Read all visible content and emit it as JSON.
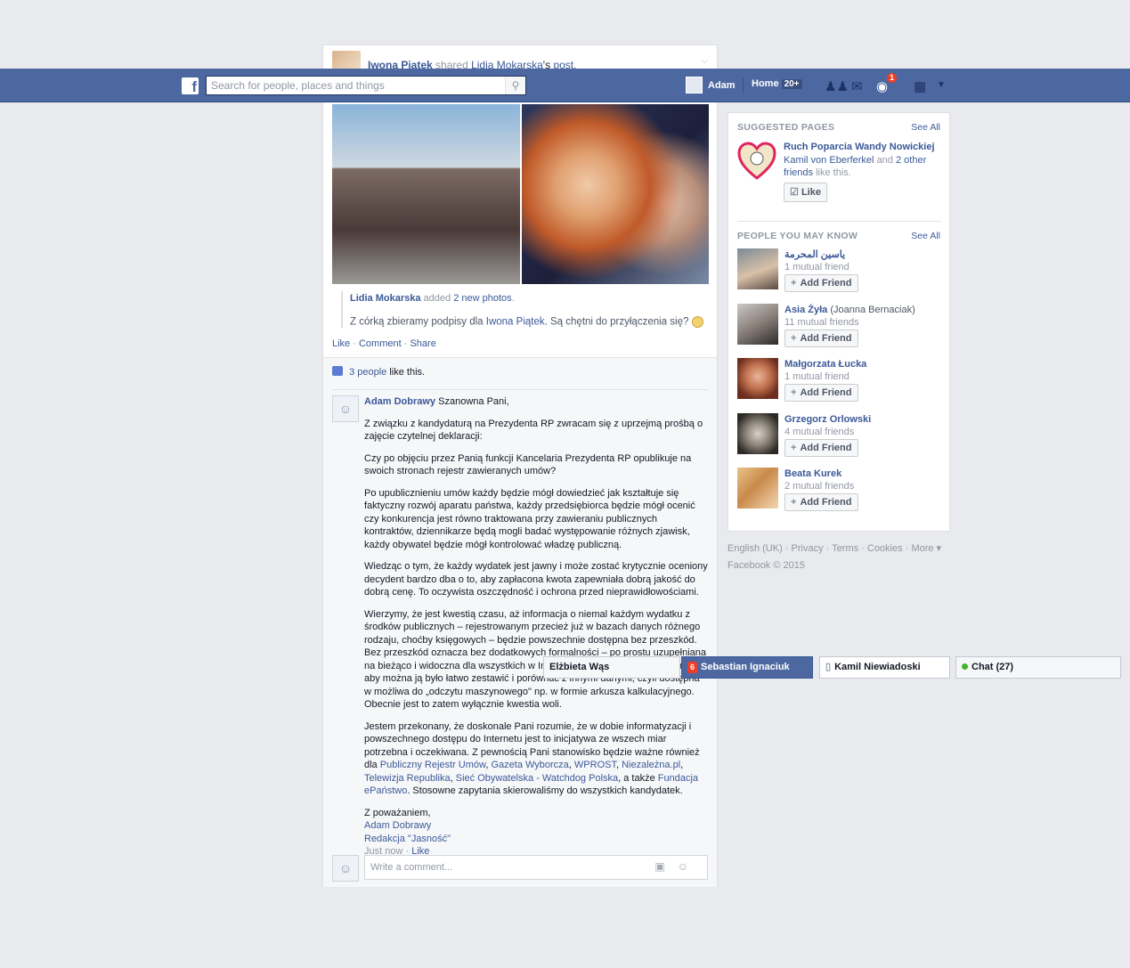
{
  "post": {
    "sharer": "Iwona Piatek",
    "shared_text": "shared",
    "original_author": "Lidia Mokarska",
    "possessive": "'s",
    "post_link": "post.",
    "shared_line_author": "Lidia Mokarska",
    "shared_line_added": "added",
    "shared_line_photos": "2 new photos",
    "shared_line_end": ".",
    "message_before": "Z córką zbieramy podpisy dla",
    "message_link": "Iwona Piątek",
    "message_after": ". Są chętni do przyłączenia się?",
    "action_like": "Like",
    "action_comment": "Comment",
    "action_share": "Share",
    "likes_count": "3 people",
    "likes_suffix": "like this."
  },
  "comment": {
    "author": "Adam Dobrawy",
    "greeting": "Szanowna Pani,",
    "p1": "Z związku z kandydaturą na Prezydenta RP zwracam się z uprzejmą prośbą o zajęcie czytelnej deklaracji:",
    "p2": "Czy po objęciu przez Panią funkcji Kancelaria Prezydenta RP opublikuje na swoich stronach rejestr zawieranych umów?",
    "p3": "Po upublicznieniu umów każdy będzie mógł dowiedzieć jak kształtuje się faktyczny rozwój aparatu państwa, każdy przedsiębiorca będzie mógł ocenić czy konkurencja jest równo traktowana przy zawieraniu publicznych kontraktów, dziennikarze będą mogli badać występowanie różnych zjawisk, każdy obywatel będzie mógł kontrolować władzę publiczną.",
    "p4": "Wiedząc o tym, że każdy wydatek jest jawny i może zostać krytycznie oceniony decydent bardzo dba o to, aby zapłacona kwota zapewniała dobrą jakość do dobrą cenę. To oczywista oszczędność i ochrona przed nieprawidłowościami.",
    "p5": "Wierzymy, że jest kwestią czasu, aż informacja o niemal każdym wydatku z środków publicznych – rejestrowanym przecież już w bazach danych różnego rodzaju, choćby księgowych – będzie powszechnie dostępna bez przeszkód. Bez przeszkód oznacza bez dodatkowych formalności – po prostu uzupełniana na bieżąco i widoczna dla wszystkich w Internecie. Co więcej udostepniana tak aby można ją było łatwo zestawić i porównać z innymi danymi, czyli dostępna w możliwa do „odczytu maszynowego\" np. w formie arkusza kalkulacyjnego. Obecnie jest to zatem wyłącznie kwestia woli.",
    "p6_before": "Jestem przekonany, że doskonale Pani rozumie, że w dobie informatyzacji i powszechnego dostępu do Internetu jest to inicjatywa ze wszech miar potrzebna i oczekiwana. Z pewnością Pani stanowisko będzie ważne również dla",
    "link1": "Publiczny Rejestr Umów",
    "link2": "Gazeta Wyborcza",
    "link3": "WPROST",
    "link4": "Niezależna.pl",
    "link5": "Telewizja Republika",
    "link6": "Sieć Obywatelska - Watchdog Polska",
    "also": ", a także",
    "link7": "Fundacja ePaństwo",
    "p6_after": ". Stosowne zapytania skierowaliśmy do wszystkich kandydatek.",
    "closing": "Z poważaniem,",
    "sign_name": "Adam Dobrawy",
    "sign_org": "Redakcja \"Jasność\"",
    "time": "Just now",
    "like": "Like",
    "write_placeholder": "Write a comment..."
  },
  "topbar": {
    "search_placeholder": "Search for people, places and things",
    "user": "Adam",
    "home": "Home",
    "home_count": "20+",
    "notif_count": "1"
  },
  "suggested": {
    "title": "SUGGESTED PAGES",
    "see_all": "See All",
    "page_name": "Ruch Poparcia Wandy Nowickiej",
    "friend1": "Kamil von Eberferkel",
    "and": "and",
    "others": "2 other friends",
    "like_this": "like this.",
    "like_btn": "Like"
  },
  "pymk": {
    "title": "PEOPLE YOU MAY KNOW",
    "see_all": "See All",
    "add_label": "Add Friend",
    "people": [
      {
        "name": "ياسين المحرمة",
        "extra": "",
        "mutual": "1 mutual friend"
      },
      {
        "name": "Asia Żyła",
        "extra": "(Joanna Bernaciak)",
        "mutual": "11 mutual friends"
      },
      {
        "name": "Małgorzata Łucka",
        "extra": "",
        "mutual": "1 mutual friend"
      },
      {
        "name": "Grzegorz Orlowski",
        "extra": "",
        "mutual": "4 mutual friends"
      },
      {
        "name": "Beata Kurek",
        "extra": "",
        "mutual": "2 mutual friends"
      }
    ]
  },
  "footer": {
    "links": [
      "English (UK)",
      "Privacy",
      "Terms",
      "Cookies",
      "More"
    ],
    "copyright": "Facebook © 2015"
  },
  "chat": {
    "tab1": "Elżbieta Wąs",
    "tab2_count": "6",
    "tab2": "Sebastian Ignaciuk",
    "tab3": "Kamil Niewiadoski",
    "tab4": "Chat (27)"
  }
}
